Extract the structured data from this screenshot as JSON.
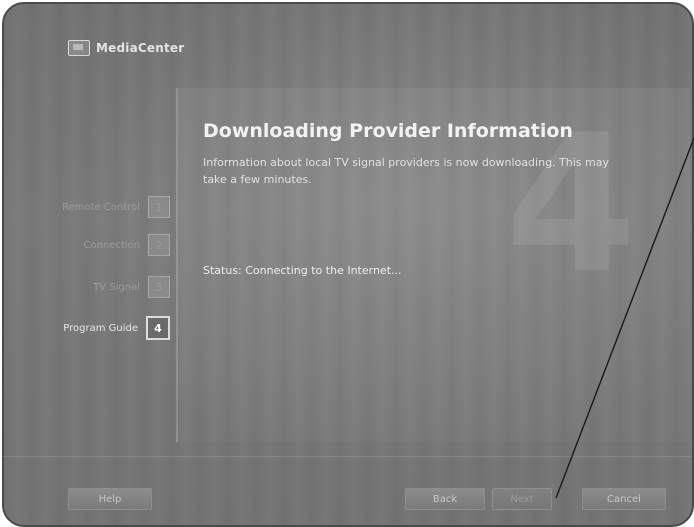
{
  "app": {
    "logo_text": "MediaCenter"
  },
  "wizard": {
    "current_step_watermark": "4",
    "steps": [
      {
        "label": "Remote Control",
        "number": "1",
        "active": false
      },
      {
        "label": "Connection",
        "number": "2",
        "active": false
      },
      {
        "label": "TV Signal",
        "number": "3",
        "active": false
      },
      {
        "label": "Program Guide",
        "number": "4",
        "active": true
      }
    ],
    "title": "Downloading Provider Information",
    "description": "Information about local TV signal providers is now downloading. This may take a few minutes.",
    "status": "Status:  Connecting to the Internet..."
  },
  "buttons": {
    "help": "Help",
    "back": "Back",
    "next": "Next",
    "cancel": "Cancel"
  }
}
